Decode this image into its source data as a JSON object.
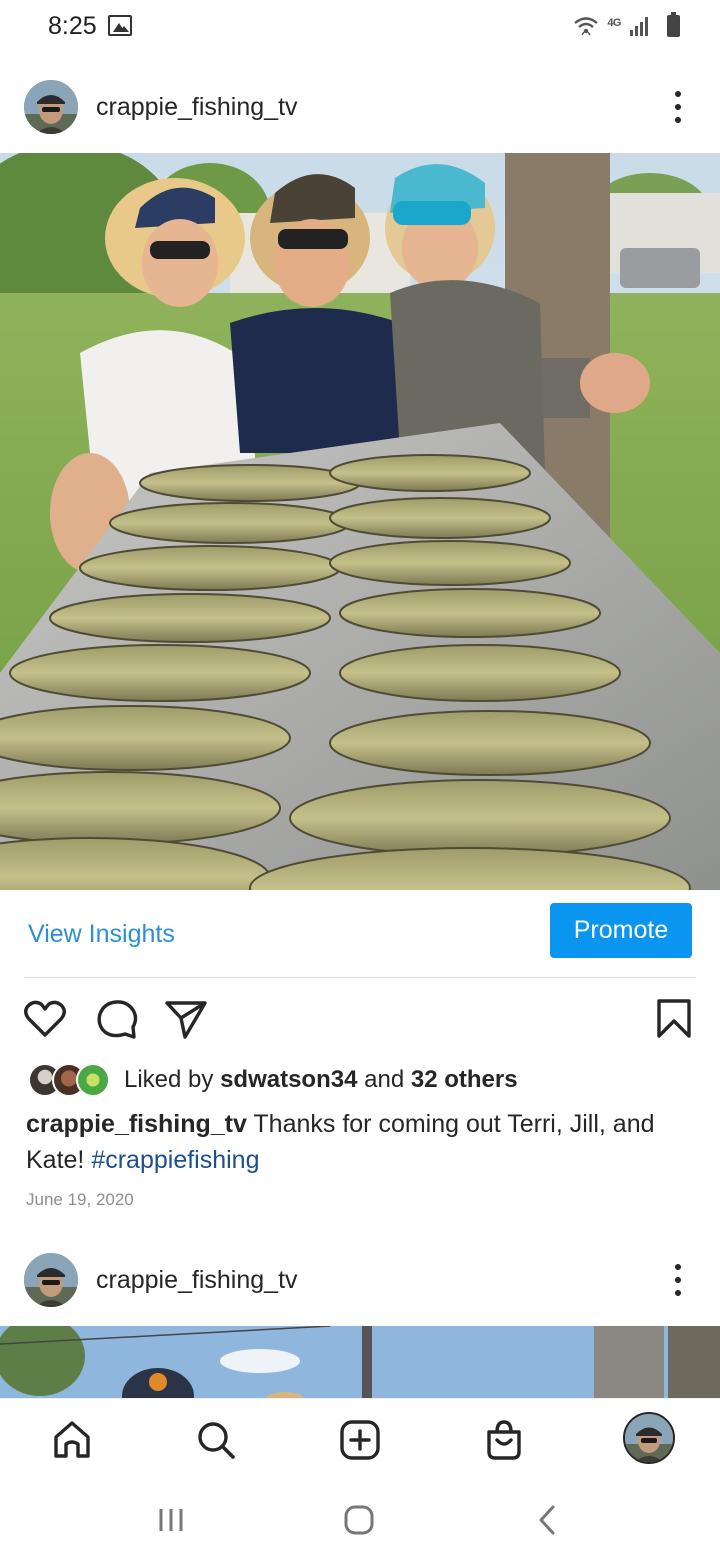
{
  "status_bar": {
    "time": "8:25",
    "network": "4G",
    "icons": [
      "gallery-icon",
      "wifi-icon",
      "signal-icon",
      "battery-icon"
    ]
  },
  "post1": {
    "username": "crappie_fishing_tv",
    "view_insights_label": "View Insights",
    "promote_label": "Promote",
    "likes": {
      "prefix": "Liked by ",
      "liker": "sdwatson34",
      "connector": " and ",
      "others": "32 others"
    },
    "caption": {
      "user": "crappie_fishing_tv",
      "text": " Thanks for coming out Terri, Jill, and Kate! ",
      "hashtag": "#crappiefishing"
    },
    "date": "June 19, 2020",
    "photo_alt": "Three women in caps and sunglasses behind a metal tray of crappie fish"
  },
  "post2": {
    "username": "crappie_fishing_tv"
  },
  "bottom_nav": {
    "items": [
      "home-icon",
      "search-icon",
      "add-post-icon",
      "shop-icon",
      "profile-avatar"
    ]
  },
  "colors": {
    "link_blue": "#2b8fd3",
    "promote_blue": "#0a95f0",
    "hashtag_blue": "#1c4f8f",
    "text": "#262626",
    "muted": "#8e8e8e"
  }
}
